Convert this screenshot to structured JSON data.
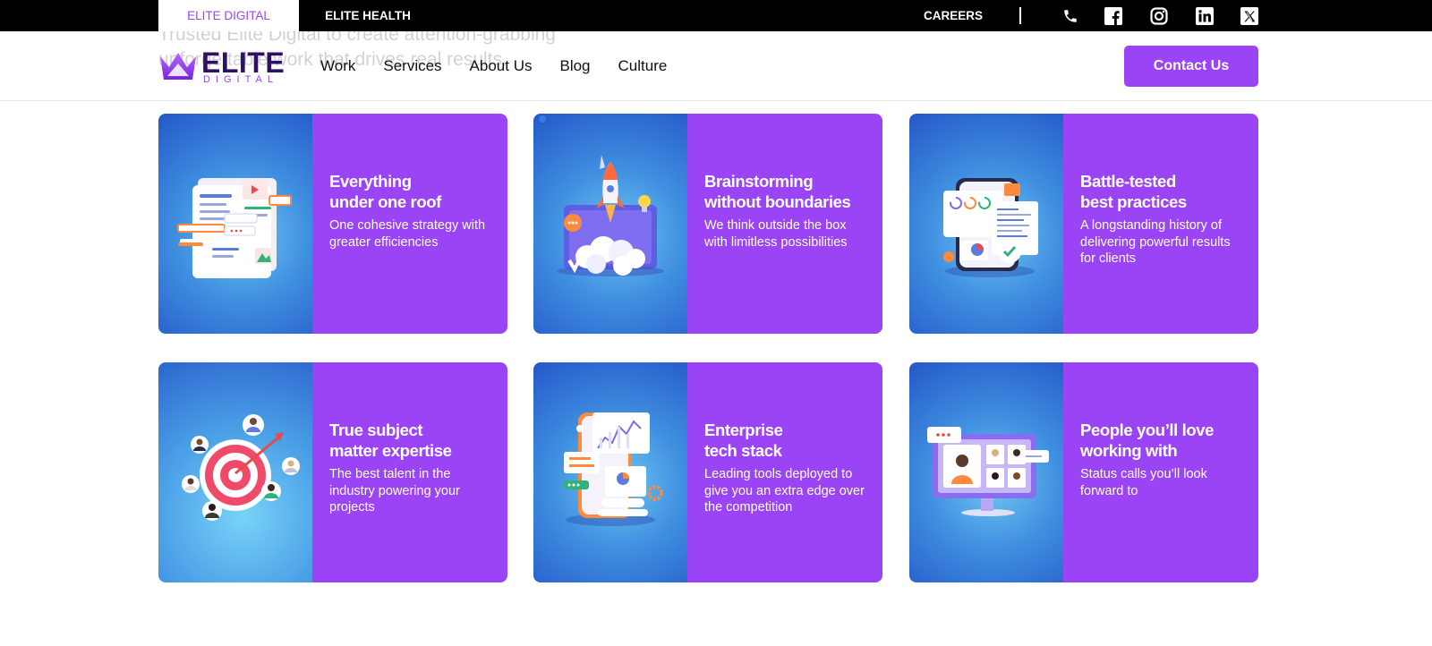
{
  "topbar": {
    "tab_active": "ELITE DIGITAL",
    "tab_other": "ELITE HEALTH",
    "careers": "CAREERS",
    "social_icons": [
      "phone-icon",
      "facebook-icon",
      "instagram-icon",
      "linkedin-icon",
      "x-icon"
    ]
  },
  "header": {
    "ghost_line1": "Trusted Elite Digital to create attention-grabbing",
    "ghost_line2": "unforgettable work that drives real results.",
    "logo_word": "ELITE",
    "logo_sub": "DIGITAL",
    "nav": [
      "Work",
      "Services",
      "About Us",
      "Blog",
      "Culture"
    ],
    "contact_label": "Contact Us"
  },
  "colors": {
    "accent": "#9b44f5",
    "topbar": "#000000",
    "card_blue": "#2f6fd6",
    "logo_dark": "#2e1065"
  },
  "cards": [
    {
      "title_1": "Everything",
      "title_2": "under one roof",
      "desc": "One cohesive strategy with greater efficiencies",
      "icon": "documents-illustration"
    },
    {
      "title_1": "Brainstorming",
      "title_2": "without boundaries",
      "desc": "We think outside the box with limitless possibilities",
      "icon": "rocket-launch-illustration"
    },
    {
      "title_1": "Battle-tested",
      "title_2": "best practices",
      "desc": "A longstanding history of delivering powerful results for clients",
      "icon": "tablet-analytics-illustration"
    },
    {
      "title_1": "True subject",
      "title_2": "matter expertise",
      "desc": "The best talent in the industry powering your projects",
      "icon": "target-people-illustration"
    },
    {
      "title_1": "Enterprise",
      "title_2": "tech stack",
      "desc": "Leading tools deployed to give you an extra edge over the competition",
      "icon": "phone-dashboard-illustration"
    },
    {
      "title_1": "People you’ll love",
      "title_2": "working with",
      "desc": "Status calls you’ll look forward to",
      "icon": "video-call-illustration"
    }
  ]
}
